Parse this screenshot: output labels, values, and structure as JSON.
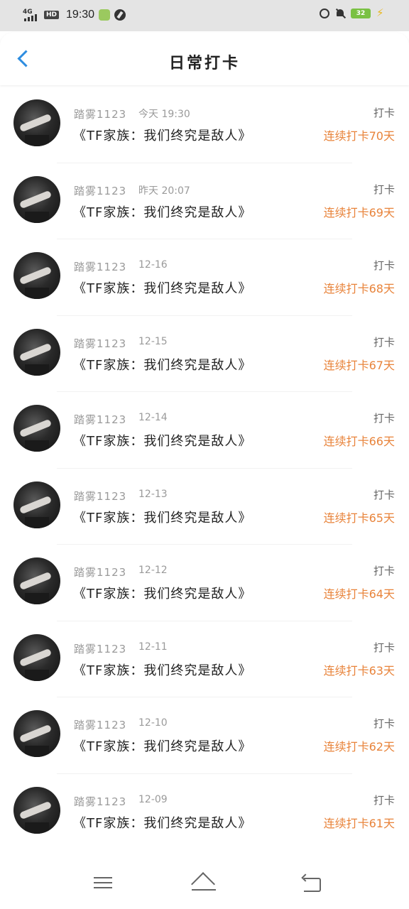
{
  "status_bar": {
    "network": "4G",
    "hd": "HD",
    "time": "19:30",
    "battery": "32"
  },
  "header": {
    "title": "日常打卡"
  },
  "entries": [
    {
      "user": "踏雾1123",
      "date": "今天 19:30",
      "book": "《TF家族：我们终究是敌人》",
      "action": "打卡",
      "streak": "连续打卡70天"
    },
    {
      "user": "踏雾1123",
      "date": "昨天 20:07",
      "book": "《TF家族：我们终究是敌人》",
      "action": "打卡",
      "streak": "连续打卡69天"
    },
    {
      "user": "踏雾1123",
      "date": "12-16",
      "book": "《TF家族：我们终究是敌人》",
      "action": "打卡",
      "streak": "连续打卡68天"
    },
    {
      "user": "踏雾1123",
      "date": "12-15",
      "book": "《TF家族：我们终究是敌人》",
      "action": "打卡",
      "streak": "连续打卡67天"
    },
    {
      "user": "踏雾1123",
      "date": "12-14",
      "book": "《TF家族：我们终究是敌人》",
      "action": "打卡",
      "streak": "连续打卡66天"
    },
    {
      "user": "踏雾1123",
      "date": "12-13",
      "book": "《TF家族：我们终究是敌人》",
      "action": "打卡",
      "streak": "连续打卡65天"
    },
    {
      "user": "踏雾1123",
      "date": "12-12",
      "book": "《TF家族：我们终究是敌人》",
      "action": "打卡",
      "streak": "连续打卡64天"
    },
    {
      "user": "踏雾1123",
      "date": "12-11",
      "book": "《TF家族：我们终究是敌人》",
      "action": "打卡",
      "streak": "连续打卡63天"
    },
    {
      "user": "踏雾1123",
      "date": "12-10",
      "book": "《TF家族：我们终究是敌人》",
      "action": "打卡",
      "streak": "连续打卡62天"
    },
    {
      "user": "踏雾1123",
      "date": "12-09",
      "book": "《TF家族：我们终究是敌人》",
      "action": "打卡",
      "streak": "连续打卡61天"
    }
  ],
  "colors": {
    "accent_blue": "#2e8de0",
    "streak_orange": "#e8833a",
    "battery_green": "#7ac143"
  },
  "icons": {
    "back": "chevron-left-icon",
    "nav_menu": "menu-icon",
    "nav_home": "home-icon",
    "nav_back": "back-icon"
  }
}
